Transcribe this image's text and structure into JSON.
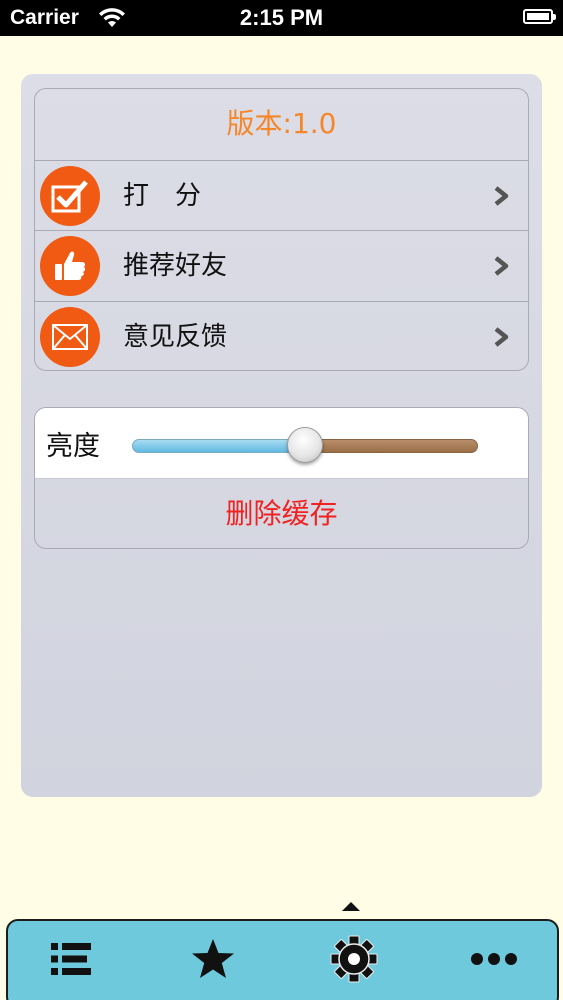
{
  "status_bar": {
    "carrier": "Carrier",
    "time": "2:15 PM"
  },
  "settings": {
    "version": "版本:1.0",
    "items": [
      {
        "label": "打分",
        "icon": "checkmark-icon"
      },
      {
        "label": "推荐好友",
        "icon": "thumbs-up-icon"
      },
      {
        "label": "意见反馈",
        "icon": "envelope-icon"
      }
    ],
    "brightness": {
      "label": "亮度",
      "value": 0.5
    },
    "clear_cache": "删除缓存"
  },
  "tab_bar": {
    "tabs": [
      {
        "icon": "list-icon"
      },
      {
        "icon": "star-icon"
      },
      {
        "icon": "gear-icon",
        "selected": true
      },
      {
        "icon": "more-icon"
      }
    ]
  },
  "colors": {
    "accent_orange": "#f5862a",
    "icon_circle": "#f05a12",
    "destructive": "#f02222",
    "tab_bar": "#6fc9dc",
    "background": "#fffde6"
  }
}
